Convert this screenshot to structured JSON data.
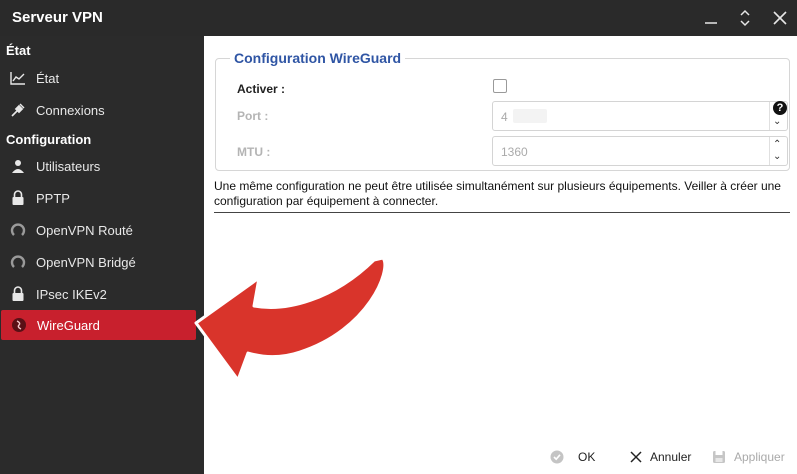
{
  "window": {
    "title": "Serveur VPN"
  },
  "sidebar": {
    "sections": [
      {
        "label": "État"
      },
      {
        "label": "Configuration"
      }
    ],
    "items": [
      {
        "label": "État",
        "icon": "chart-line-icon"
      },
      {
        "label": "Connexions",
        "icon": "plug-icon"
      },
      {
        "label": "Utilisateurs",
        "icon": "user-icon"
      },
      {
        "label": "PPTP",
        "icon": "lock-icon"
      },
      {
        "label": "OpenVPN Routé",
        "icon": "openvpn-icon"
      },
      {
        "label": "OpenVPN Bridgé",
        "icon": "openvpn-icon"
      },
      {
        "label": "IPsec IKEv2",
        "icon": "lock-icon"
      },
      {
        "label": "WireGuard",
        "icon": "wireguard-icon",
        "active": true
      }
    ]
  },
  "form": {
    "legend": "Configuration WireGuard",
    "activate_label": "Activer :",
    "port_label": "Port :",
    "port_value": "4",
    "mtu_label": "MTU :",
    "mtu_value": "1360"
  },
  "info_text": "Une même configuration ne peut être utilisée simultanément sur plusieurs équipements. Veiller à créer une configuration par équipement à connecter.",
  "footer": {
    "ok_label": "OK",
    "cancel_label": "Annuler",
    "apply_label": "Appliquer"
  },
  "colors": {
    "accent_red": "#c8202d",
    "legend_blue": "#2f55a4",
    "arrow_red": "#d9342b"
  }
}
